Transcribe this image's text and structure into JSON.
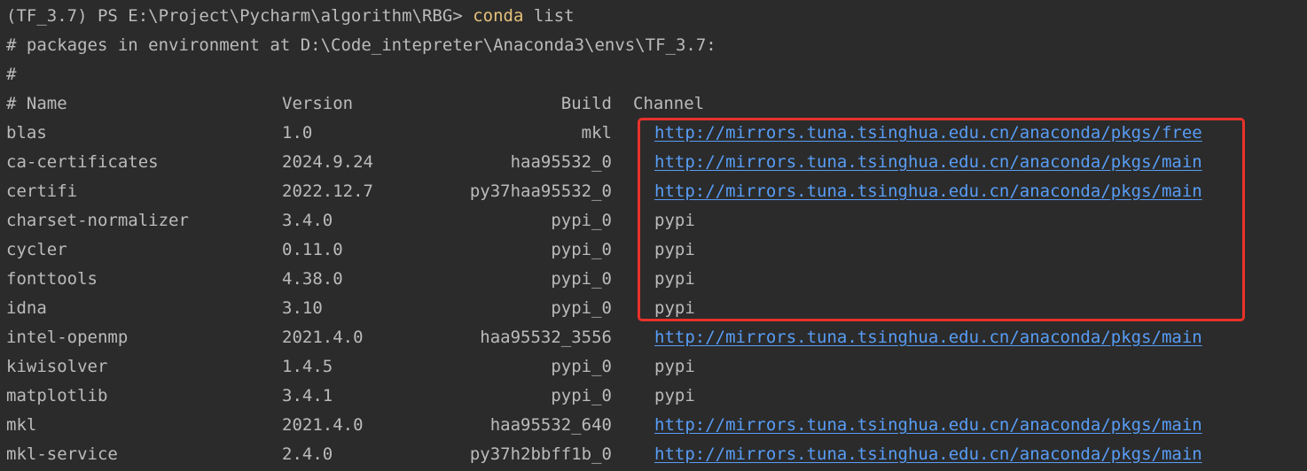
{
  "prompt": {
    "prefix": "(TF_3.7) PS E:\\Project\\Pycharm\\algorithm\\RBG> ",
    "command": "conda",
    "args": " list"
  },
  "header_lines": [
    "# packages in environment at D:\\Code_intepreter\\Anaconda3\\envs\\TF_3.7:",
    "#"
  ],
  "table": {
    "headers": {
      "name": "# Name",
      "version": "Version",
      "build": "Build",
      "channel": "Channel"
    },
    "rows": [
      {
        "name": "blas",
        "version": "1.0",
        "build": "mkl",
        "channel": "http://mirrors.tuna.tsinghua.edu.cn/anaconda/pkgs/free",
        "is_link": true
      },
      {
        "name": "ca-certificates",
        "version": "2024.9.24",
        "build": "haa95532_0",
        "channel": "http://mirrors.tuna.tsinghua.edu.cn/anaconda/pkgs/main",
        "is_link": true
      },
      {
        "name": "certifi",
        "version": "2022.12.7",
        "build": "py37haa95532_0",
        "channel": "http://mirrors.tuna.tsinghua.edu.cn/anaconda/pkgs/main",
        "is_link": true
      },
      {
        "name": "charset-normalizer",
        "version": "3.4.0",
        "build": "pypi_0",
        "channel": "pypi",
        "is_link": false
      },
      {
        "name": "cycler",
        "version": "0.11.0",
        "build": "pypi_0",
        "channel": "pypi",
        "is_link": false
      },
      {
        "name": "fonttools",
        "version": "4.38.0",
        "build": "pypi_0",
        "channel": "pypi",
        "is_link": false
      },
      {
        "name": "idna",
        "version": "3.10",
        "build": "pypi_0",
        "channel": "pypi",
        "is_link": false
      },
      {
        "name": "intel-openmp",
        "version": "2021.4.0",
        "build": "haa95532_3556",
        "channel": "http://mirrors.tuna.tsinghua.edu.cn/anaconda/pkgs/main",
        "is_link": true
      },
      {
        "name": "kiwisolver",
        "version": "1.4.5",
        "build": "pypi_0",
        "channel": "pypi",
        "is_link": false
      },
      {
        "name": "matplotlib",
        "version": "3.4.1",
        "build": "pypi_0",
        "channel": "pypi",
        "is_link": false
      },
      {
        "name": "mkl",
        "version": "2021.4.0",
        "build": "haa95532_640",
        "channel": "http://mirrors.tuna.tsinghua.edu.cn/anaconda/pkgs/main",
        "is_link": true
      },
      {
        "name": "mkl-service",
        "version": "2.4.0",
        "build": "py37h2bbff1b_0",
        "channel": "http://mirrors.tuna.tsinghua.edu.cn/anaconda/pkgs/main",
        "is_link": true
      }
    ]
  },
  "colors": {
    "background": "#2b2b2b",
    "text": "#bbbbbb",
    "command": "#e5c07b",
    "link": "#589df6",
    "highlight_box": "#e8322a"
  }
}
